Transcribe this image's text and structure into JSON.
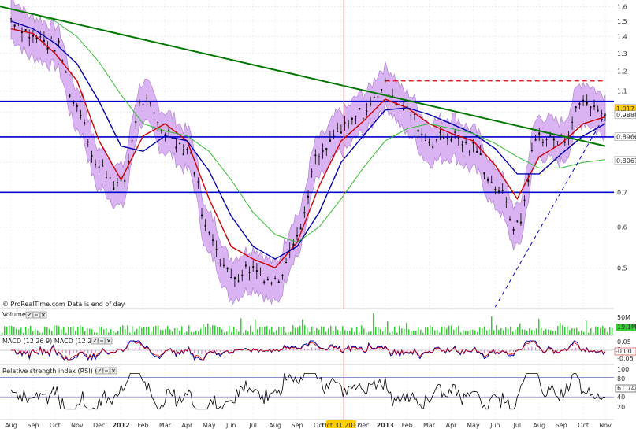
{
  "source_note": "© ProRealTime.com Data is end of day",
  "price_axis": {
    "ticks": [
      "1.6",
      "1.5",
      "1.4",
      "1.3",
      "1.2",
      "1.1",
      "1",
      "0.9",
      "0.8",
      "0.7",
      "0.6",
      "0.5"
    ],
    "tick_values": [
      1.6,
      1.5,
      1.4,
      1.3,
      1.2,
      1.1,
      1.0,
      0.9,
      0.8,
      0.7,
      0.6,
      0.5
    ],
    "labels": [
      {
        "text": "1.017",
        "value": 1.017,
        "color": "#ffcc00"
      },
      {
        "text": "0.9888",
        "value": 0.9888,
        "color": "#ffffff"
      },
      {
        "text": "0.8966",
        "value": 0.8966,
        "color": "#ffffff"
      },
      {
        "text": "0.8067",
        "value": 0.8067,
        "color": "#ffffff"
      }
    ]
  },
  "x_axis": {
    "labels": [
      "Aug",
      "Sep",
      "Oct",
      "Nov",
      "Dec",
      "2012",
      "Feb",
      "Mar",
      "Apr",
      "May",
      "Jun",
      "Jul",
      "Aug",
      "Sep",
      "Oct",
      "Oct 31 2012",
      "Dec",
      "2013",
      "Feb",
      "Mar",
      "Apr",
      "May",
      "Jun",
      "Jul",
      "Aug",
      "Sep",
      "Oct",
      "Nov"
    ],
    "bold": [
      "2012",
      "2013"
    ],
    "highlight": "Oct 31 2012",
    "highlight_color": "#ffcc00"
  },
  "panels": {
    "volume": {
      "title": "Volume",
      "tick": "50M",
      "value_label": "19.1M"
    },
    "macd": {
      "title": "MACD (12 26 9) MACD (12 26 9)",
      "ticks": [
        "0.05",
        "0",
        "-0.05"
      ],
      "value_label": "-0.0014"
    },
    "rsi": {
      "title": "Relative strength index (RSI) (14)",
      "ticks": [
        "100",
        "80",
        "60",
        "40",
        "20"
      ],
      "value_label": "61.746"
    }
  },
  "colors": {
    "candle": "#000000",
    "band_fill": "#cc99ee",
    "ma_fast": "#cc0000",
    "ma_mid": "#0000aa",
    "ma_slow": "#33bb33",
    "trendline": "#007700",
    "hline": "#0000cc",
    "dashed_red": "#dd0000",
    "volume_bar": "#33cc33",
    "grid": "#dddddd",
    "rsi_line": "#000000",
    "rsi_band": "#6666cc"
  },
  "chart_data": {
    "type": "line",
    "title": "",
    "ylabel": "",
    "ylim": [
      0.42,
      1.62
    ],
    "x": [
      "2011-08",
      "2011-09",
      "2011-10",
      "2011-11",
      "2011-12",
      "2012-01",
      "2012-02",
      "2012-03",
      "2012-04",
      "2012-05",
      "2012-06",
      "2012-07",
      "2012-08",
      "2012-09",
      "2012-10",
      "2012-11",
      "2012-12",
      "2013-01",
      "2013-02",
      "2013-03",
      "2013-04",
      "2013-05",
      "2013-06",
      "2013-07",
      "2013-08",
      "2013-09",
      "2013-10",
      "2013-11"
    ],
    "series": [
      {
        "values": [
          1.52,
          1.4,
          1.35,
          1.02,
          0.78,
          0.72,
          1.05,
          0.92,
          0.85,
          0.58,
          0.48,
          0.5,
          0.47,
          0.58,
          0.82,
          0.92,
          1.0,
          1.12,
          1.0,
          0.88,
          0.9,
          0.85,
          0.72,
          0.6,
          0.9,
          0.88,
          1.05,
          0.99
        ]
      },
      {
        "values": [
          1.45,
          1.42,
          1.3,
          1.15,
          0.88,
          0.74,
          0.9,
          0.95,
          0.88,
          0.68,
          0.55,
          0.52,
          0.5,
          0.56,
          0.72,
          0.88,
          0.96,
          1.06,
          1.02,
          0.95,
          0.91,
          0.88,
          0.79,
          0.68,
          0.82,
          0.87,
          0.95,
          0.98
        ]
      },
      {
        "values": [
          1.5,
          1.45,
          1.36,
          1.24,
          1.05,
          0.86,
          0.84,
          0.9,
          0.88,
          0.77,
          0.63,
          0.55,
          0.52,
          0.55,
          0.64,
          0.8,
          0.9,
          1.01,
          1.02,
          0.99,
          0.95,
          0.91,
          0.85,
          0.76,
          0.76,
          0.83,
          0.9,
          0.95
        ]
      },
      {
        "values": [
          1.58,
          1.55,
          1.5,
          1.4,
          1.25,
          1.08,
          0.95,
          0.92,
          0.9,
          0.84,
          0.74,
          0.64,
          0.58,
          0.56,
          0.6,
          0.68,
          0.78,
          0.88,
          0.93,
          0.95,
          0.93,
          0.91,
          0.87,
          0.82,
          0.78,
          0.78,
          0.8,
          0.81
        ]
      }
    ],
    "trendline": {
      "x": [
        "2011-07",
        "2013-11"
      ],
      "y": [
        1.62,
        0.86
      ]
    },
    "support_line": {
      "x": [
        "2013-06",
        "2013-11"
      ],
      "y": [
        0.42,
        0.99
      ]
    },
    "horizontal_lines": [
      1.05,
      0.896,
      0.7
    ],
    "resistance_dashed": {
      "value": 1.15,
      "x": [
        "2013-01",
        "2013-11"
      ]
    },
    "current_price": 1.017,
    "volume_unit": "M",
    "rsi_levels": [
      80,
      40
    ]
  }
}
